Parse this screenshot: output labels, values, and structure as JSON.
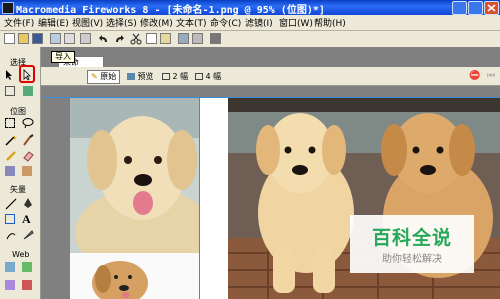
{
  "window": {
    "title": "Macromedia Fireworks 8 - [未命名-1.png @  95% (位图)*]"
  },
  "menu": [
    "文件(F)",
    "编辑(E)",
    "视图(V)",
    "选择(S)",
    "修改(M)",
    "文本(T)",
    "命令(C)",
    "滤镜(I)",
    "窗口(W)",
    "帮助(H)"
  ],
  "tools": {
    "sections": {
      "select": "选择",
      "bitmap": "位图",
      "vector": "矢量",
      "web": "Web"
    }
  },
  "tooltip": "导入",
  "document": {
    "tab_label": "未命名-1.png*",
    "views": {
      "original": "原始",
      "preview": "预览",
      "two_up": "2 幅",
      "four_up": "4 幅"
    }
  },
  "watermark": {
    "title": "百科全说",
    "subtitle": "助你轻松解决"
  },
  "colors": {
    "titlebar": "#1046d6",
    "highlight": "#e00000",
    "watermark_green": "#25a85a"
  }
}
